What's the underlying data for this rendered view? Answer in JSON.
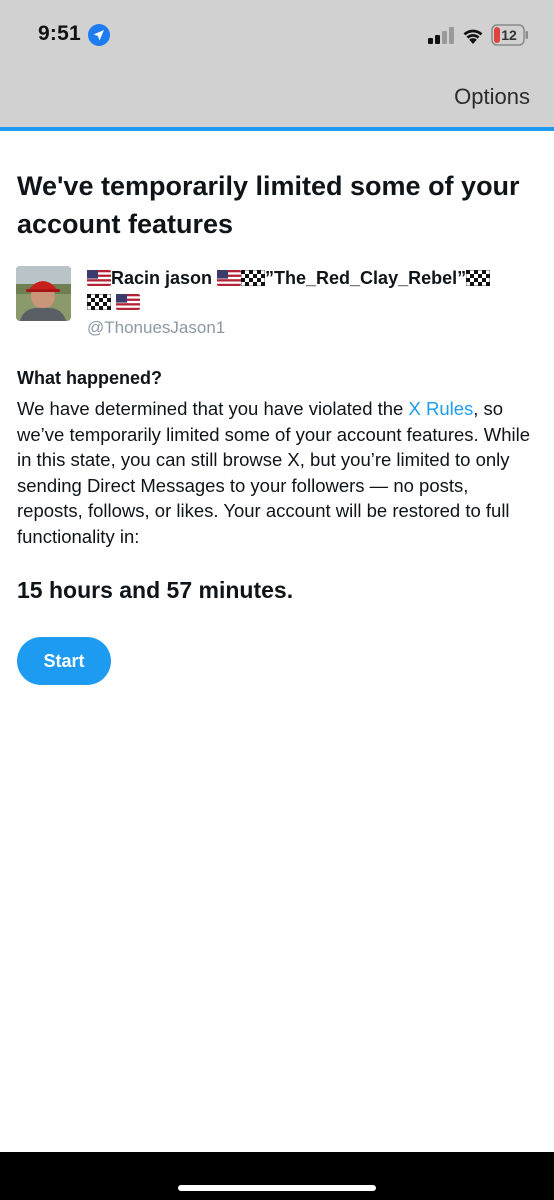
{
  "status_bar": {
    "time": "9:51",
    "battery_level": "12",
    "icons": [
      "location-arrow-icon",
      "cellular-signal-icon",
      "wifi-icon",
      "battery-icon"
    ]
  },
  "nav": {
    "options_label": "Options"
  },
  "colors": {
    "accent": "#1d9bf0",
    "nav_background": "#d1d1d1",
    "text": "#0f1419",
    "secondary_text": "#8b98a5",
    "battery_low": "#e0443e"
  },
  "page": {
    "headline": "We've temporarily limited some of your account features",
    "user": {
      "display_name_line1_a": "Racin jason ",
      "display_name_line1_b": "”The_Red_Clay_Rebel”",
      "handle": "@ThonuesJason1",
      "emoji_icons": [
        "us-flag-icon",
        "checkered-flag-icon"
      ]
    },
    "section_title": "What happened?",
    "body_part1": "We have determined that you have violated the ",
    "rules_link": "X Rules",
    "body_part2": ", so we’ve temporarily limited some of your account features. While in this state, you can still browse X, but you’re limited to only sending Direct Messages to your followers — no posts, reposts, follows, or likes. Your account will be restored to full functionality in:",
    "countdown": "15 hours and 57 minutes.",
    "start_button": "Start"
  }
}
